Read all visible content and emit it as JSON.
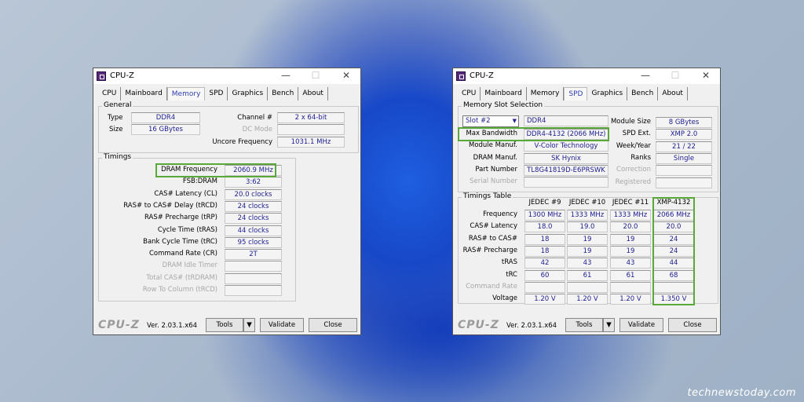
{
  "watermark": "technewstoday.com",
  "common": {
    "title": "CPU-Z",
    "tabs": [
      "CPU",
      "Mainboard",
      "Memory",
      "SPD",
      "Graphics",
      "Bench",
      "About"
    ],
    "logo": "CPU-Z",
    "version": "Ver. 2.03.1.x64",
    "tools": "Tools",
    "validate": "Validate",
    "close": "Close",
    "minimize": "—",
    "maximize": "☐",
    "close_x": "✕"
  },
  "memory": {
    "general_label": "General",
    "type_label": "Type",
    "type": "DDR4",
    "size_label": "Size",
    "size": "16 GBytes",
    "channel_label": "Channel #",
    "channel": "2 x 64-bit",
    "dcmode_label": "DC Mode",
    "dcmode": "",
    "uncore_label": "Uncore Frequency",
    "uncore": "1031.1 MHz",
    "timings_label": "Timings",
    "timings": [
      {
        "label": "DRAM Frequency",
        "value": "2060.9 MHz"
      },
      {
        "label": "FSB:DRAM",
        "value": "3:62"
      },
      {
        "label": "CAS# Latency (CL)",
        "value": "20.0 clocks"
      },
      {
        "label": "RAS# to CAS# Delay (tRCD)",
        "value": "24 clocks"
      },
      {
        "label": "RAS# Precharge (tRP)",
        "value": "24 clocks"
      },
      {
        "label": "Cycle Time (tRAS)",
        "value": "44 clocks"
      },
      {
        "label": "Bank Cycle Time (tRC)",
        "value": "95 clocks"
      },
      {
        "label": "Command Rate (CR)",
        "value": "2T"
      },
      {
        "label": "DRAM Idle Timer",
        "value": ""
      },
      {
        "label": "Total CAS# (tRDRAM)",
        "value": ""
      },
      {
        "label": "Row To Column (tRCD)",
        "value": ""
      }
    ]
  },
  "spd": {
    "slot_group_label": "Memory Slot Selection",
    "slot": "Slot #2",
    "mem_type": "DDR4",
    "left_rows": [
      {
        "label": "Max Bandwidth",
        "value": "DDR4-4132 (2066 MHz)"
      },
      {
        "label": "Module Manuf.",
        "value": "V-Color Technology"
      },
      {
        "label": "DRAM Manuf.",
        "value": "SK Hynix"
      },
      {
        "label": "Part Number",
        "value": "TL8G41819D-E6PRSWK"
      },
      {
        "label": "Serial Number",
        "value": ""
      }
    ],
    "right_rows": [
      {
        "label": "Module Size",
        "value": "8 GBytes"
      },
      {
        "label": "SPD Ext.",
        "value": "XMP 2.0"
      },
      {
        "label": "Week/Year",
        "value": "21 / 22"
      },
      {
        "label": "Ranks",
        "value": "Single"
      },
      {
        "label": "Correction",
        "value": ""
      },
      {
        "label": "Registered",
        "value": ""
      }
    ],
    "timings_table_label": "Timings Table",
    "columns": [
      "JEDEC #9",
      "JEDEC #10",
      "JEDEC #11",
      "XMP-4132"
    ],
    "rows": [
      {
        "label": "Frequency",
        "values": [
          "1300 MHz",
          "1333 MHz",
          "1333 MHz",
          "2066 MHz"
        ]
      },
      {
        "label": "CAS# Latency",
        "values": [
          "18.0",
          "19.0",
          "20.0",
          "20.0"
        ]
      },
      {
        "label": "RAS# to CAS#",
        "values": [
          "18",
          "19",
          "19",
          "24"
        ]
      },
      {
        "label": "RAS# Precharge",
        "values": [
          "18",
          "19",
          "19",
          "24"
        ]
      },
      {
        "label": "tRAS",
        "values": [
          "42",
          "43",
          "43",
          "44"
        ]
      },
      {
        "label": "tRC",
        "values": [
          "60",
          "61",
          "61",
          "68"
        ]
      },
      {
        "label": "Command Rate",
        "values": [
          "",
          "",
          "",
          ""
        ]
      },
      {
        "label": "Voltage",
        "values": [
          "1.20 V",
          "1.20 V",
          "1.20 V",
          "1.350 V"
        ]
      }
    ]
  }
}
